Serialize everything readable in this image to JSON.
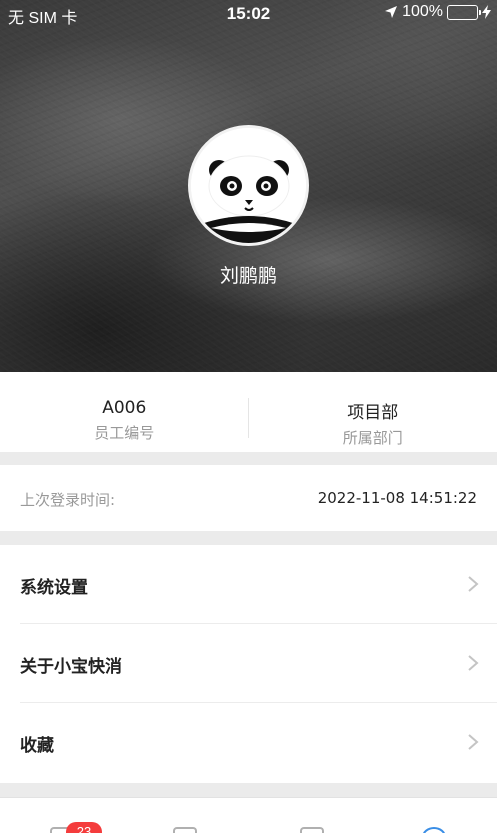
{
  "status_bar": {
    "carrier": "无 SIM 卡",
    "time": "15:02",
    "battery_percent": "100%",
    "battery_level": 1.0,
    "icons": [
      "location-arrow-icon",
      "battery-icon",
      "charging-bolt-icon"
    ]
  },
  "profile": {
    "name": "刘鹏鹏",
    "avatar_icon": "panda-avatar"
  },
  "info": {
    "employee_id": "A006",
    "employee_id_label": "员工编号",
    "department": "项目部",
    "department_label": "所属部门"
  },
  "login": {
    "label": "上次登录时间:",
    "value": "2022-11-08 14:51:22"
  },
  "menu": {
    "items": [
      {
        "label": "系统设置",
        "icon": "chevron-right-icon"
      },
      {
        "label": "关于小宝快消",
        "icon": "chevron-right-icon"
      },
      {
        "label": "收藏",
        "icon": "chevron-right-icon"
      }
    ]
  },
  "tabbar": {
    "badge": "23"
  },
  "colors": {
    "accent_green": "#4cd964",
    "badge_red": "#f43c3c",
    "text_primary": "#222222",
    "text_secondary": "#999999"
  }
}
